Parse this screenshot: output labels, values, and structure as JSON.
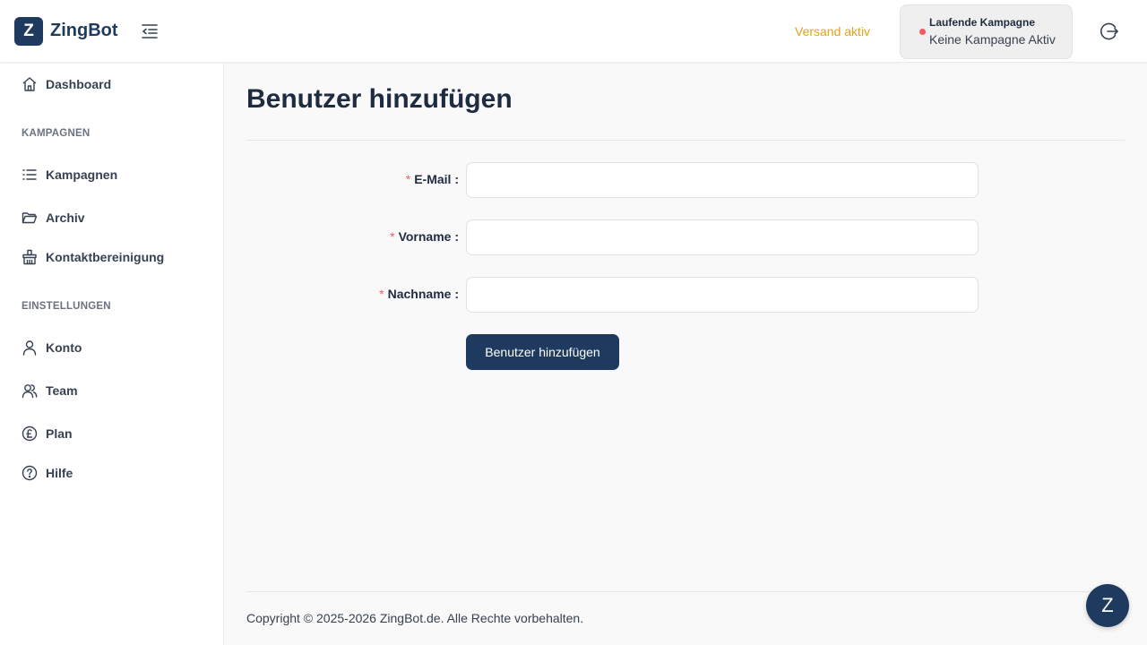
{
  "brand": {
    "logo_letter": "Z",
    "name": "ZingBot",
    "accent": "#1e3a5f"
  },
  "header": {
    "status_text": "Versand aktiv",
    "status_color": "#e0a31a",
    "campaign": {
      "title": "Laufende Kampagne",
      "value": "Keine Kampagne Aktiv",
      "dot_color": "#f05a63"
    },
    "collapse_icon": "menu-collapse-icon",
    "logout_icon": "logout-icon"
  },
  "sidebar": {
    "items": [
      {
        "label": "Dashboard",
        "icon": "home-icon"
      },
      {
        "label": "Kampagnen",
        "icon": "list-icon"
      },
      {
        "label": "Archiv",
        "icon": "folder-icon"
      },
      {
        "label": "Kontaktbereinigung",
        "icon": "broom-icon"
      },
      {
        "label": "Konto",
        "icon": "user-icon"
      },
      {
        "label": "Team",
        "icon": "team-icon"
      },
      {
        "label": "Plan",
        "icon": "pound-icon"
      },
      {
        "label": "Hilfe",
        "icon": "help-icon"
      }
    ],
    "sections": [
      "KAMPAGNEN",
      "EINSTELLUNGEN"
    ]
  },
  "main": {
    "title": "Benutzer hinzufügen",
    "form": {
      "required_marker": "*",
      "fields": [
        {
          "label": "E-Mail",
          "value": "",
          "placeholder": ""
        },
        {
          "label": "Vorname",
          "value": "",
          "placeholder": ""
        },
        {
          "label": "Nachname",
          "value": "",
          "placeholder": ""
        }
      ],
      "submit_label": "Benutzer hinzufügen"
    }
  },
  "footer": {
    "copyright": "Copyright © 2025-2026 ZingBot.de. Alle Rechte vorbehalten."
  },
  "chat": {
    "letter": "Z",
    "icon": "chat-widget-icon"
  }
}
